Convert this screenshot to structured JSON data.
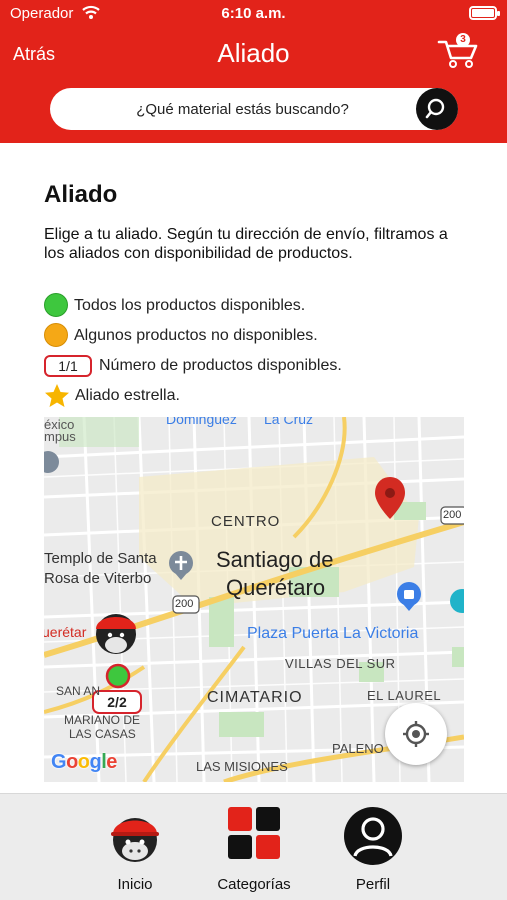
{
  "status_bar": {
    "carrier": "Operador",
    "time": "6:10 a.m."
  },
  "nav": {
    "back_label": "Atrás",
    "title": "Aliado",
    "cart_count": "3"
  },
  "search": {
    "placeholder": "¿Qué material estás buscando?"
  },
  "main": {
    "title": "Aliado",
    "description": "Elige a tu aliado. Según tu dirección de envío, filtramos a los aliados con disponibilidad de productos.",
    "legend": [
      {
        "symbol": "green-dot",
        "text": "Todos los productos disponibles."
      },
      {
        "symbol": "orange-dot",
        "text": "Algunos productos no disponibles."
      },
      {
        "symbol": "count-pill",
        "badge": "1/1",
        "text": "Número de productos disponibles."
      },
      {
        "symbol": "star",
        "text": "Aliado estrella."
      }
    ]
  },
  "map": {
    "labels": {
      "dominguez": "Dominguez",
      "la_cruz": "La Cruz",
      "mexico": "éxico",
      "campus": "mpus",
      "centro": "CENTRO",
      "templo_1": "Templo de Santa",
      "templo_2": "Rosa de Viterbo",
      "city_1": "Santiago de",
      "city_2": "Querétaro",
      "route_200_top": "200",
      "route_200_mid": "200",
      "plaza": "Plaza Puerta La Victoria",
      "villas": "VILLAS DEL SUR",
      "queretaro_partial": "uerétar",
      "cimatario": "CIMATARIO",
      "el_laurel": "EL LAUREL",
      "san_an": "SAN AN",
      "mariano_1": "MARIANO DE",
      "mariano_2": "LAS CASAS",
      "paleno": "PALENO",
      "las_misiones": "LAS MISIONES",
      "google": "Google"
    },
    "ally_badge": "2/2",
    "colors": {
      "accent_blue": "#3b7ee6",
      "park_green": "#c8e6c0",
      "highway_yellow": "#f6cf63",
      "pin_red": "#d32b22"
    }
  },
  "tabbar": {
    "items": [
      {
        "label": "Inicio",
        "icon": "gorilla-icon"
      },
      {
        "label": "Categorías",
        "icon": "grid-icon"
      },
      {
        "label": "Perfil",
        "icon": "user-icon"
      }
    ]
  },
  "colors": {
    "brand": "#e2231a",
    "status_green": "#3ec73e",
    "status_orange": "#f5a816",
    "star": "#f7b500"
  }
}
